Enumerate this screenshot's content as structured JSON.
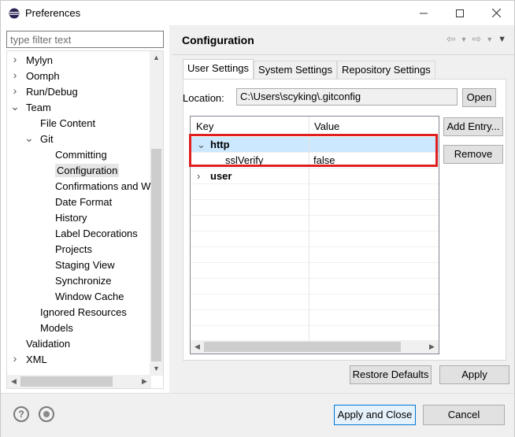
{
  "window": {
    "title": "Preferences",
    "minimize_icon": "minimize-icon",
    "maximize_icon": "maximize-icon",
    "close_icon": "close-icon"
  },
  "sidebar": {
    "filter_placeholder": "type filter text",
    "items": [
      {
        "label": "Mylyn",
        "level": 0,
        "expander": "collapsed"
      },
      {
        "label": "Oomph",
        "level": 0,
        "expander": "collapsed"
      },
      {
        "label": "Run/Debug",
        "level": 0,
        "expander": "collapsed"
      },
      {
        "label": "Team",
        "level": 0,
        "expander": "expanded"
      },
      {
        "label": "File Content",
        "level": 1,
        "expander": "none"
      },
      {
        "label": "Git",
        "level": 1,
        "expander": "expanded"
      },
      {
        "label": "Committing",
        "level": 2,
        "expander": "none"
      },
      {
        "label": "Configuration",
        "level": 2,
        "expander": "none",
        "selected": true
      },
      {
        "label": "Confirmations and W",
        "level": 2,
        "expander": "none"
      },
      {
        "label": "Date Format",
        "level": 2,
        "expander": "none"
      },
      {
        "label": "History",
        "level": 2,
        "expander": "none"
      },
      {
        "label": "Label Decorations",
        "level": 2,
        "expander": "none"
      },
      {
        "label": "Projects",
        "level": 2,
        "expander": "none"
      },
      {
        "label": "Staging View",
        "level": 2,
        "expander": "none"
      },
      {
        "label": "Synchronize",
        "level": 2,
        "expander": "none"
      },
      {
        "label": "Window Cache",
        "level": 2,
        "expander": "none"
      },
      {
        "label": "Ignored Resources",
        "level": 1,
        "expander": "none"
      },
      {
        "label": "Models",
        "level": 1,
        "expander": "none"
      },
      {
        "label": "Validation",
        "level": 0,
        "expander": "none"
      },
      {
        "label": "XML",
        "level": 0,
        "expander": "collapsed"
      }
    ]
  },
  "page": {
    "title": "Configuration",
    "tabs": [
      {
        "label": "User Settings",
        "active": true
      },
      {
        "label": "System Settings",
        "active": false
      },
      {
        "label": "Repository Settings",
        "active": false
      }
    ],
    "location_label": "Location:",
    "location_value": "C:\\Users\\scyking\\.gitconfig",
    "open_button": "Open",
    "add_entry_button": "Add Entry...",
    "remove_button": "Remove",
    "table": {
      "columns": [
        "Key",
        "Value"
      ],
      "rows": [
        {
          "key": "http",
          "value": "",
          "expander": "expanded",
          "bold": true,
          "selected": true
        },
        {
          "key": "sslVerify",
          "value": "false",
          "expander": "none",
          "bold": false,
          "child": true
        },
        {
          "key": "user",
          "value": "",
          "expander": "collapsed",
          "bold": true
        }
      ]
    },
    "restore_defaults_button": "Restore Defaults",
    "apply_button": "Apply"
  },
  "footer": {
    "help_icon": "help-icon",
    "import_export_icon": "import-export-icon",
    "apply_close_button": "Apply and Close",
    "cancel_button": "Cancel"
  },
  "colors": {
    "selection_blue": "#cce8ff",
    "highlight_red": "#e02020"
  }
}
